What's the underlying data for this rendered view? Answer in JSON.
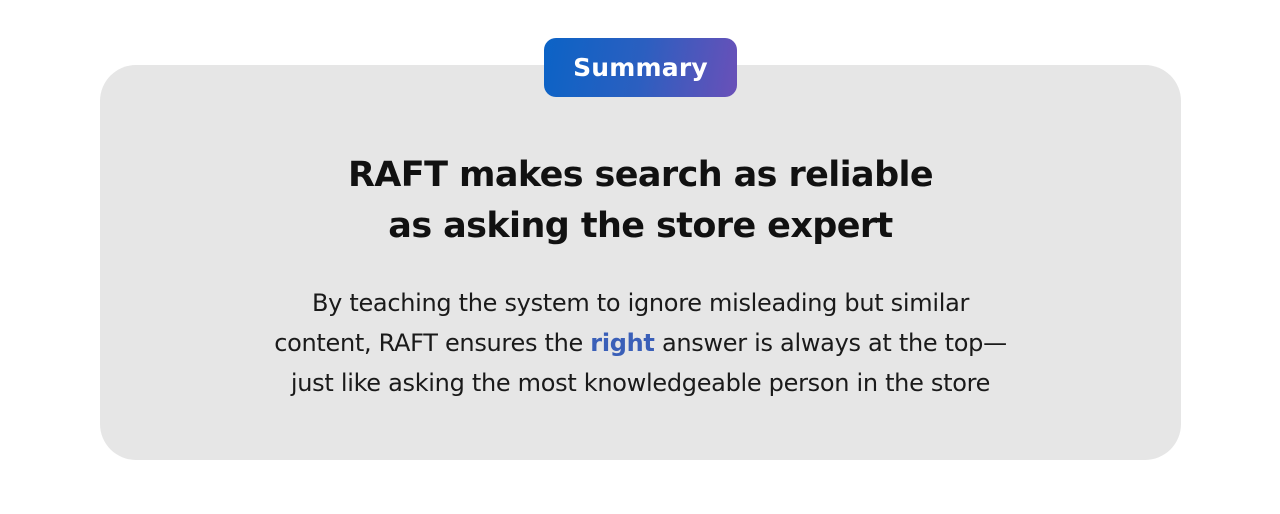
{
  "badge": {
    "label": "Summary"
  },
  "headline": {
    "line1": "RAFT makes search as reliable",
    "line2": "as asking the store expert"
  },
  "body": {
    "line1": "By teaching the system to ignore misleading but similar",
    "line2_before": "content, RAFT ensures the ",
    "line2_emphasis": "right",
    "line2_after": " answer is always at the top—",
    "line3": "just like asking the most knowledgeable person in the store"
  },
  "colors": {
    "card_background": "#e6e6e6",
    "badge_gradient_start": "#0b63c6",
    "badge_gradient_end": "#6a50b8",
    "emphasis": "#3a5fb8"
  }
}
